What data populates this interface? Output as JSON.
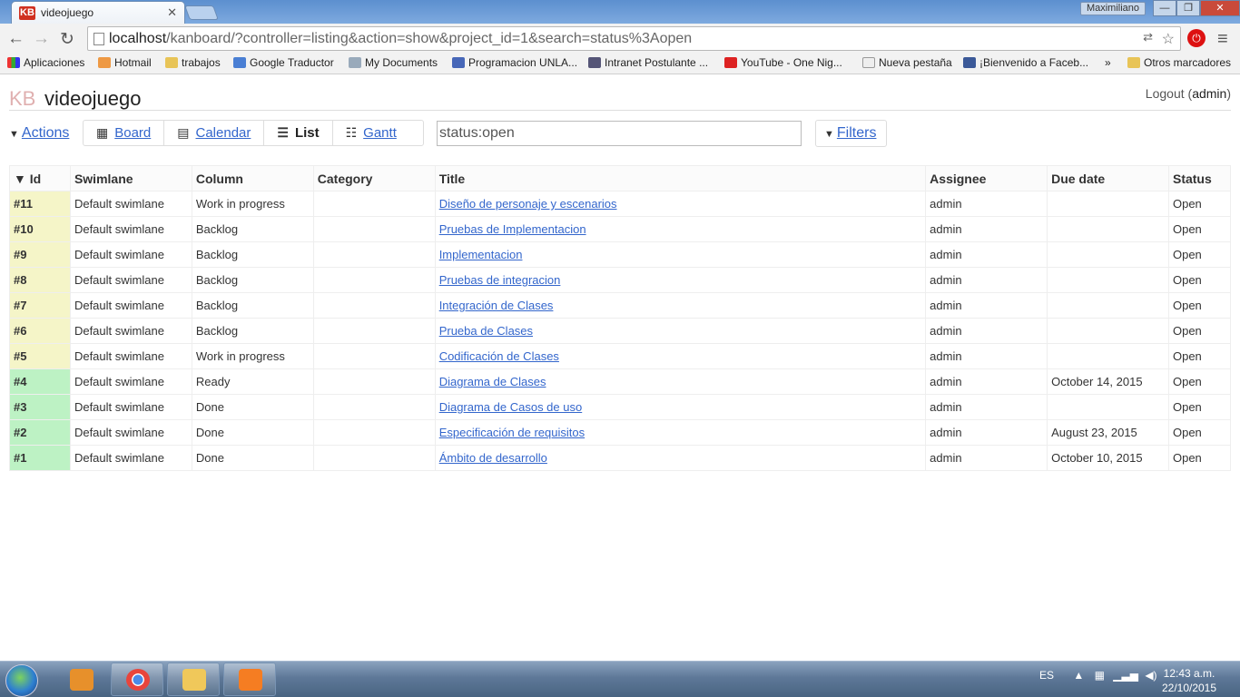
{
  "browser": {
    "tab_title": "videojuego",
    "user_name": "Maximiliano",
    "url_host": "localhost",
    "url_rest": "/kanboard/?controller=listing&action=show&project_id=1&search=status%3Aopen",
    "bookmarks": [
      "Aplicaciones",
      "Hotmail",
      "trabajos",
      "Google Traductor",
      "My Documents",
      "Programacion UNLA...",
      "Intranet Postulante ...",
      "YouTube - One Nig...",
      "Nueva pestaña",
      "¡Bienvenido a Faceb...",
      "»",
      "Otros marcadores"
    ]
  },
  "header": {
    "logo": "KB",
    "project_title": "videojuego",
    "logout_label": "Logout",
    "user": "admin"
  },
  "toolbar": {
    "actions_label": "Actions",
    "views": [
      "Board",
      "Calendar",
      "List",
      "Gantt"
    ],
    "search_value": "status:open",
    "filters_label": "Filters"
  },
  "table": {
    "columns": [
      "▼ Id",
      "Swimlane",
      "Column",
      "Category",
      "Title",
      "Assignee",
      "Due date",
      "Status"
    ],
    "rows": [
      {
        "id": "#11",
        "swimlane": "Default swimlane",
        "column": "Work in progress",
        "category": "",
        "title": "Diseño de personaje y escenarios",
        "assignee": "admin",
        "due": "",
        "status": "Open",
        "color": "yellow"
      },
      {
        "id": "#10",
        "swimlane": "Default swimlane",
        "column": "Backlog",
        "category": "",
        "title": "Pruebas de Implementacion",
        "assignee": "admin",
        "due": "",
        "status": "Open",
        "color": "yellow"
      },
      {
        "id": "#9",
        "swimlane": "Default swimlane",
        "column": "Backlog",
        "category": "",
        "title": "Implementacion",
        "assignee": "admin",
        "due": "",
        "status": "Open",
        "color": "yellow"
      },
      {
        "id": "#8",
        "swimlane": "Default swimlane",
        "column": "Backlog",
        "category": "",
        "title": "Pruebas de integracion",
        "assignee": "admin",
        "due": "",
        "status": "Open",
        "color": "yellow"
      },
      {
        "id": "#7",
        "swimlane": "Default swimlane",
        "column": "Backlog",
        "category": "",
        "title": "Integración de Clases",
        "assignee": "admin",
        "due": "",
        "status": "Open",
        "color": "yellow"
      },
      {
        "id": "#6",
        "swimlane": "Default swimlane",
        "column": "Backlog",
        "category": "",
        "title": "Prueba de Clases",
        "assignee": "admin",
        "due": "",
        "status": "Open",
        "color": "yellow"
      },
      {
        "id": "#5",
        "swimlane": "Default swimlane",
        "column": "Work in progress",
        "category": "",
        "title": "Codificación de Clases",
        "assignee": "admin",
        "due": "",
        "status": "Open",
        "color": "yellow"
      },
      {
        "id": "#4",
        "swimlane": "Default swimlane",
        "column": "Ready",
        "category": "",
        "title": "Diagrama de Clases",
        "assignee": "admin",
        "due": "October 14, 2015",
        "status": "Open",
        "color": "green"
      },
      {
        "id": "#3",
        "swimlane": "Default swimlane",
        "column": "Done",
        "category": "",
        "title": "Diagrama de Casos de uso",
        "assignee": "admin",
        "due": "",
        "status": "Open",
        "color": "green"
      },
      {
        "id": "#2",
        "swimlane": "Default swimlane",
        "column": "Done",
        "category": "",
        "title": "Especificación de requisitos",
        "assignee": "admin",
        "due": "August 23, 2015",
        "status": "Open",
        "color": "green"
      },
      {
        "id": "#1",
        "swimlane": "Default swimlane",
        "column": "Done",
        "category": "",
        "title": "Ámbito de desarrollo",
        "assignee": "admin",
        "due": "October 10, 2015",
        "status": "Open",
        "color": "green"
      }
    ]
  },
  "taskbar": {
    "language": "ES",
    "time": "12:43 a.m.",
    "date": "22/10/2015"
  }
}
